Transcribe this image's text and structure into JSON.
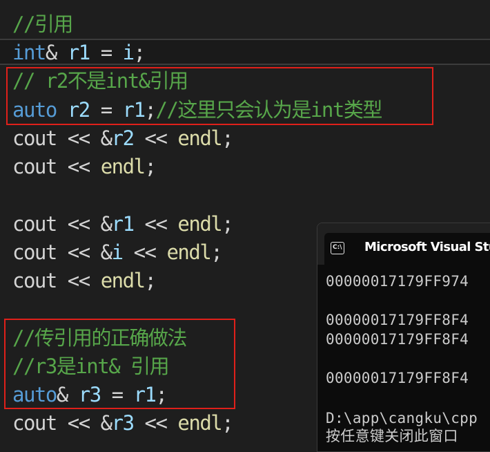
{
  "editor": {
    "lines": [
      {
        "tokens": [
          {
            "t": "//引用",
            "c": "cm"
          }
        ]
      },
      {
        "tokens": [
          {
            "t": "int",
            "c": "kw"
          },
          {
            "t": "& ",
            "c": "op"
          },
          {
            "t": "r1",
            "c": "var"
          },
          {
            "t": " = ",
            "c": "op"
          },
          {
            "t": "i",
            "c": "var"
          },
          {
            "t": ";",
            "c": "op"
          }
        ]
      },
      {
        "tokens": [
          {
            "t": "// r2不是int&引用",
            "c": "cm"
          }
        ]
      },
      {
        "tokens": [
          {
            "t": "auto",
            "c": "kw"
          },
          {
            "t": " ",
            "c": "op"
          },
          {
            "t": "r2",
            "c": "var"
          },
          {
            "t": " = ",
            "c": "op"
          },
          {
            "t": "r1",
            "c": "var"
          },
          {
            "t": ";",
            "c": "op"
          },
          {
            "t": "//这里只会认为是int类型",
            "c": "cm"
          }
        ]
      },
      {
        "tokens": [
          {
            "t": "cout",
            "c": "op"
          },
          {
            "t": " << &",
            "c": "op"
          },
          {
            "t": "r2",
            "c": "var"
          },
          {
            "t": " << ",
            "c": "op"
          },
          {
            "t": "endl",
            "c": "fn"
          },
          {
            "t": ";",
            "c": "op"
          }
        ]
      },
      {
        "tokens": [
          {
            "t": "cout",
            "c": "op"
          },
          {
            "t": " << ",
            "c": "op"
          },
          {
            "t": "endl",
            "c": "fn"
          },
          {
            "t": ";",
            "c": "op"
          }
        ]
      },
      {
        "tokens": []
      },
      {
        "tokens": [
          {
            "t": "cout",
            "c": "op"
          },
          {
            "t": " << &",
            "c": "op"
          },
          {
            "t": "r1",
            "c": "var"
          },
          {
            "t": " << ",
            "c": "op"
          },
          {
            "t": "endl",
            "c": "fn"
          },
          {
            "t": ";",
            "c": "op"
          }
        ]
      },
      {
        "tokens": [
          {
            "t": "cout",
            "c": "op"
          },
          {
            "t": " << &",
            "c": "op"
          },
          {
            "t": "i",
            "c": "var"
          },
          {
            "t": " << ",
            "c": "op"
          },
          {
            "t": "endl",
            "c": "fn"
          },
          {
            "t": ";",
            "c": "op"
          }
        ]
      },
      {
        "tokens": [
          {
            "t": "cout",
            "c": "op"
          },
          {
            "t": " << ",
            "c": "op"
          },
          {
            "t": "endl",
            "c": "fn"
          },
          {
            "t": ";",
            "c": "op"
          }
        ]
      },
      {
        "tokens": []
      },
      {
        "tokens": [
          {
            "t": "//传引用的正确做法",
            "c": "cm"
          }
        ]
      },
      {
        "tokens": [
          {
            "t": "//r3是int& 引用",
            "c": "cm"
          }
        ]
      },
      {
        "tokens": [
          {
            "t": "auto",
            "c": "kw"
          },
          {
            "t": "& ",
            "c": "op"
          },
          {
            "t": "r3",
            "c": "var"
          },
          {
            "t": " = ",
            "c": "op"
          },
          {
            "t": "r1",
            "c": "var"
          },
          {
            "t": ";",
            "c": "op"
          }
        ]
      },
      {
        "tokens": [
          {
            "t": "cout",
            "c": "op"
          },
          {
            "t": " << &",
            "c": "op"
          },
          {
            "t": "r3",
            "c": "var"
          },
          {
            "t": " << ",
            "c": "op"
          },
          {
            "t": "endl",
            "c": "fn"
          },
          {
            "t": ";",
            "c": "op"
          }
        ]
      }
    ]
  },
  "console": {
    "title": "Microsoft Visual Studio",
    "icon": "terminal-icon",
    "icon_text": "C:\\",
    "output": [
      "00000017179FF974",
      "",
      "00000017179FF8F4",
      "00000017179FF8F4",
      "",
      "00000017179FF8F4",
      "",
      "D:\\app\\cangku\\cpp",
      "按任意键关闭此窗口"
    ]
  },
  "colors": {
    "background": "#1e1e1e",
    "keyword": "#569cd6",
    "variable": "#9cdcfe",
    "function": "#dcdcaa",
    "comment": "#57a64a",
    "highlight_box": "#e0201a",
    "console_bg": "#0c0c0c"
  }
}
